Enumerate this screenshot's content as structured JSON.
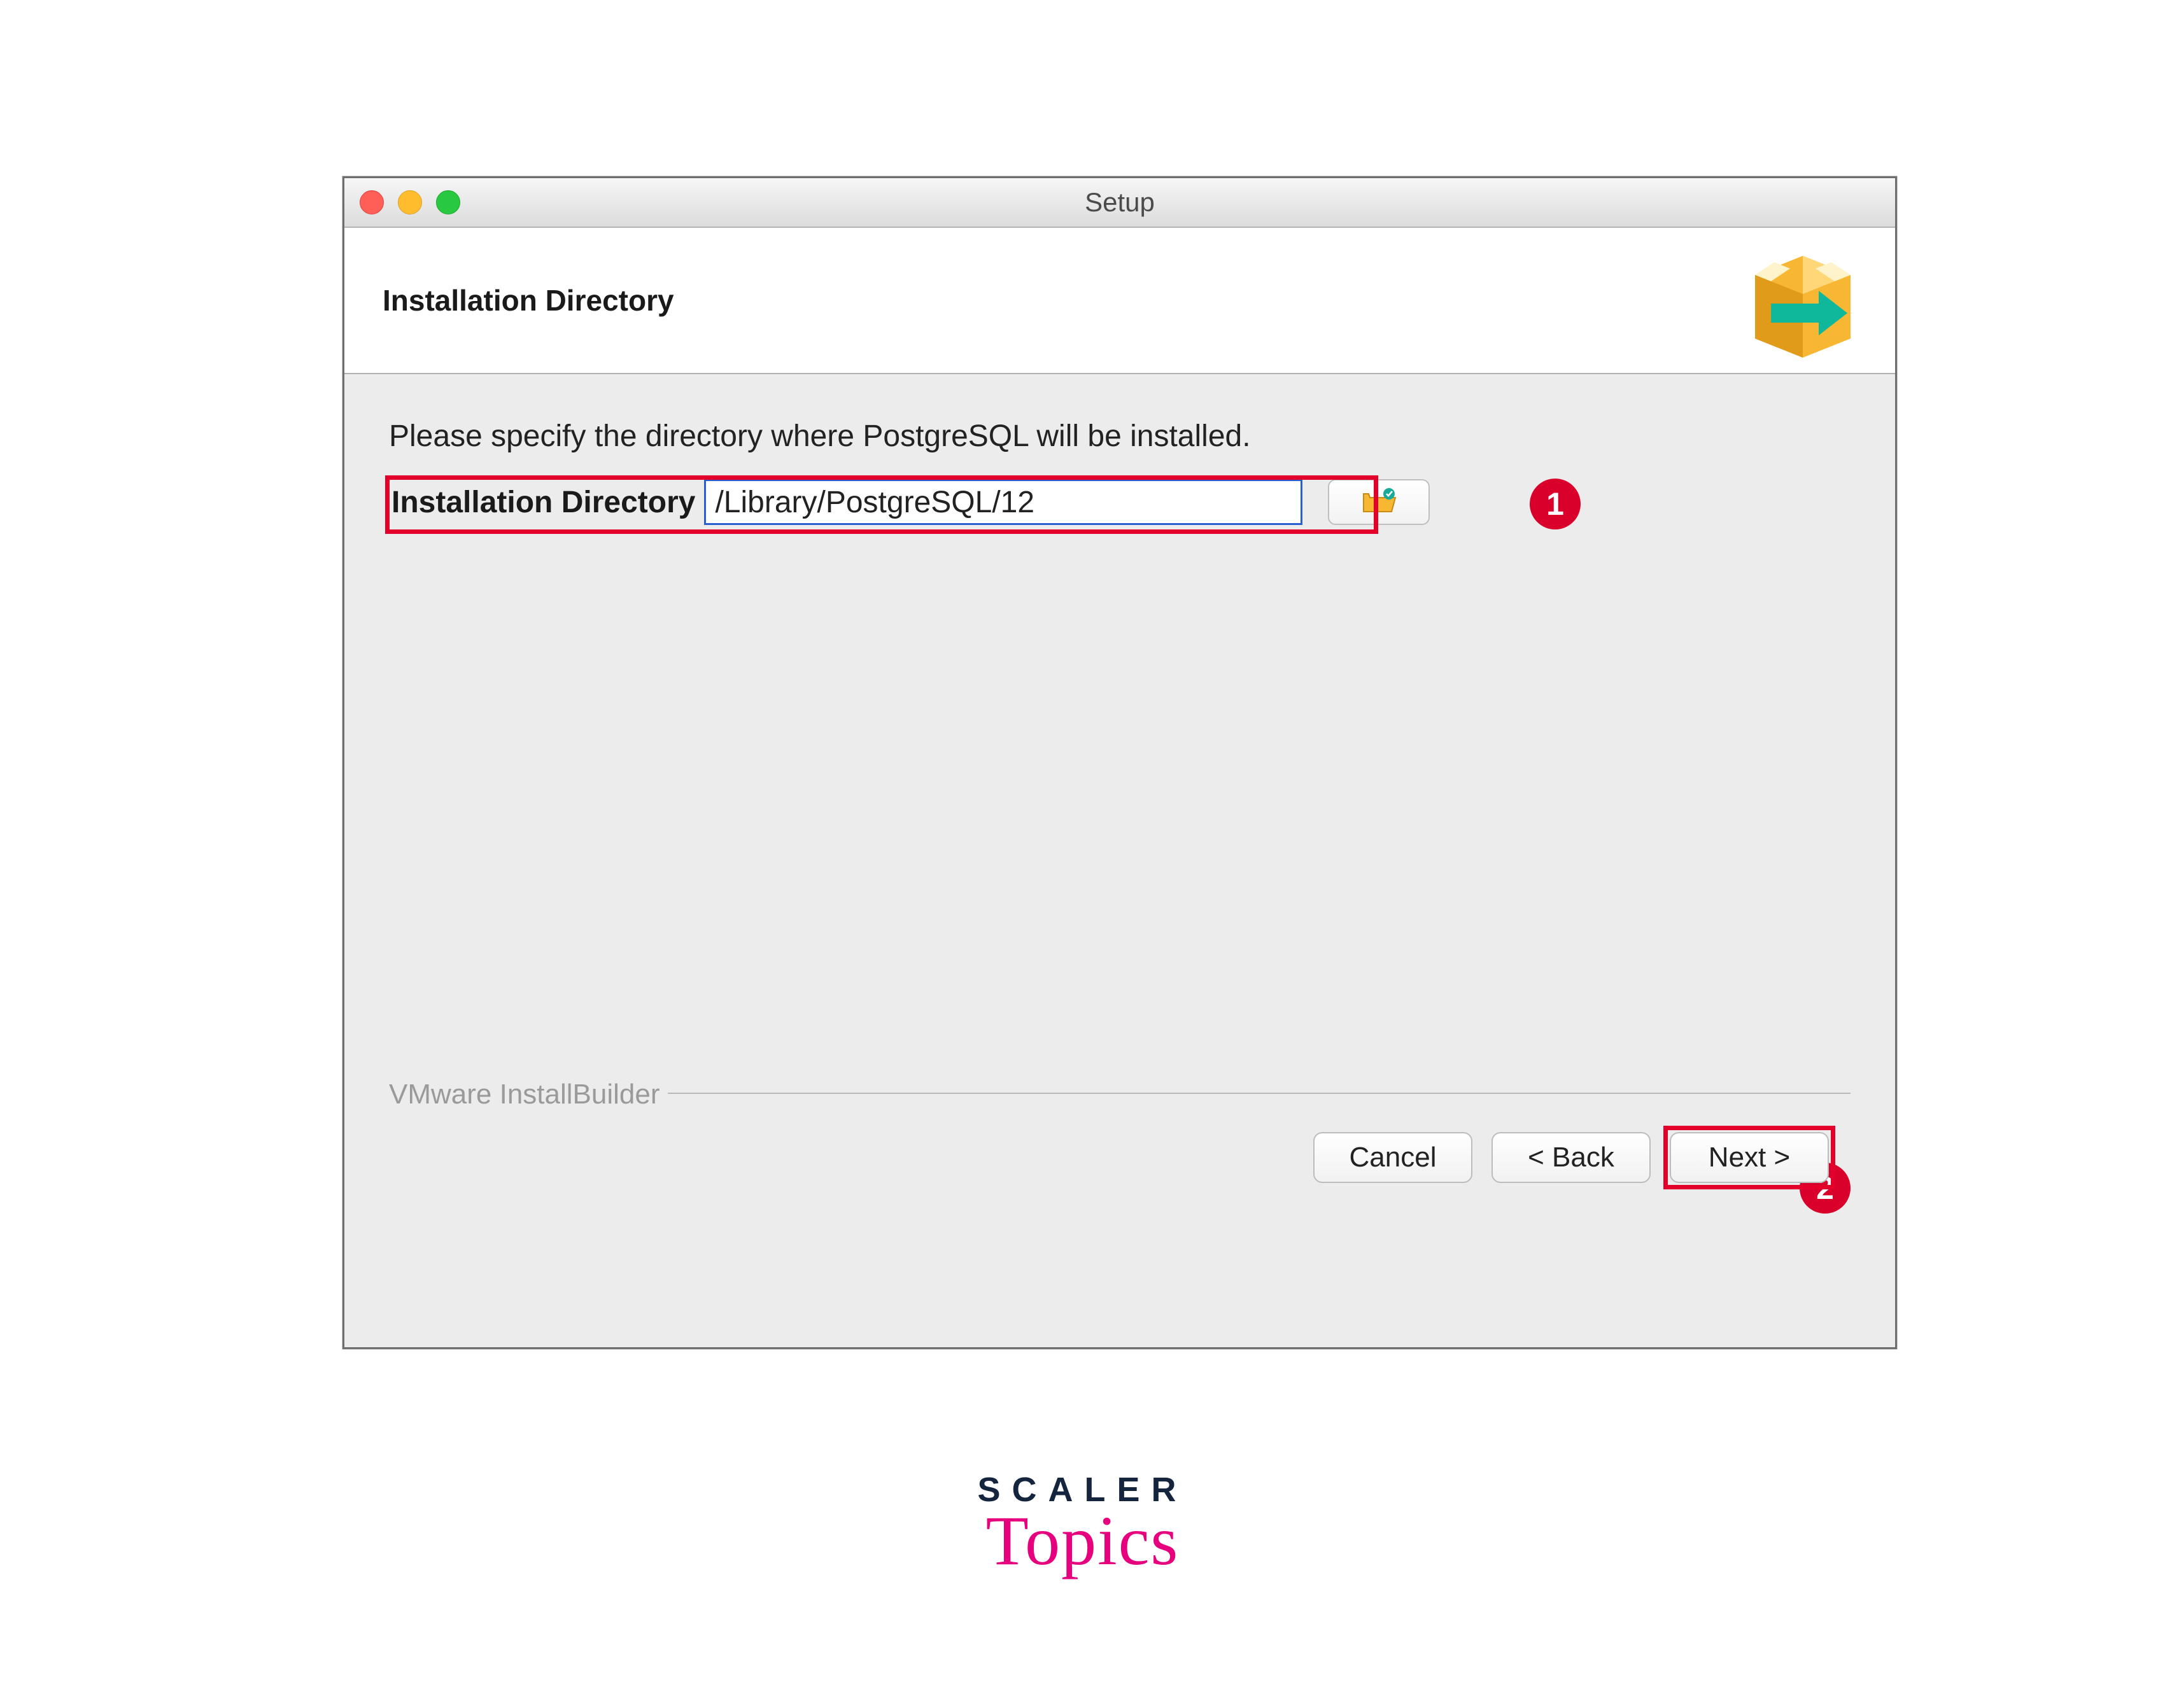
{
  "window": {
    "title": "Setup"
  },
  "header": {
    "title": "Installation Directory"
  },
  "content": {
    "prompt": "Please specify the directory where PostgreSQL will be installed.",
    "field_label": "Installation Directory",
    "field_value": "/Library/PostgreSQL/12"
  },
  "callouts": {
    "one": "1",
    "two": "2"
  },
  "footer": {
    "frame_label": "VMware InstallBuilder",
    "cancel": "Cancel",
    "back": "< Back",
    "next": "Next >"
  },
  "watermark": {
    "line1": "SCALER",
    "line2": "Topics"
  }
}
